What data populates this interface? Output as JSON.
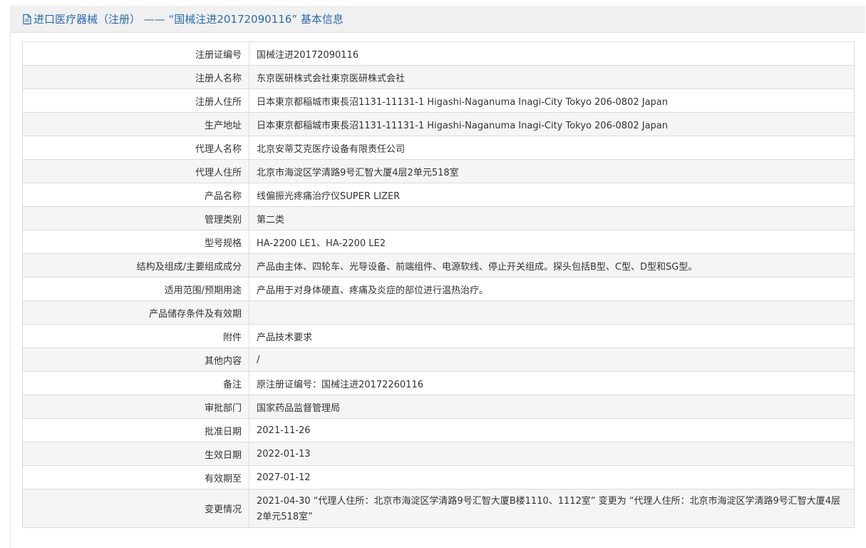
{
  "header": {
    "icon": "document-icon",
    "title": "进口医疗器械（注册） ——  “国械注进20172090116” 基本信息",
    "color": "#2a6bb0"
  },
  "rows": [
    {
      "label": "注册证编号",
      "value": "国械注进20172090116"
    },
    {
      "label": "注册人名称",
      "value": "东京医研株式会社東京医研株式会社"
    },
    {
      "label": "注册人住所",
      "value": "日本東京都稲城市東長沼1131-11131-1 Higashi-Naganuma Inagi-City Tokyo 206-0802 Japan"
    },
    {
      "label": "生产地址",
      "value": "日本東京都稲城市東長沼1131-11131-1 Higashi-Naganuma Inagi-City Tokyo 206-0802 Japan"
    },
    {
      "label": "代理人名称",
      "value": "北京安蒂艾克医疗设备有限责任公司"
    },
    {
      "label": "代理人住所",
      "value": "北京市海淀区学清路9号汇智大厦4层2单元518室"
    },
    {
      "label": "产品名称",
      "value": "线偏振光疼痛治疗仪SUPER LIZER"
    },
    {
      "label": "管理类别",
      "value": "第二类"
    },
    {
      "label": "型号规格",
      "value": "HA-2200 LE1、HA-2200 LE2"
    },
    {
      "label": "结构及组成/主要组成成分",
      "value": "产品由主体、四轮车、光导设备、前端组件、电源软线、停止开关组成。探头包括B型、C型、D型和SG型。"
    },
    {
      "label": "适用范围/预期用途",
      "value": "产品用于对身体硬直、疼痛及炎症的部位进行温热治疗。"
    },
    {
      "label": "产品储存条件及有效期",
      "value": ""
    },
    {
      "label": "附件",
      "value": "产品技术要求"
    },
    {
      "label": "其他内容",
      "value": "/"
    },
    {
      "label": "备注",
      "value": "原注册证编号：国械注进20172260116"
    },
    {
      "label": "审批部门",
      "value": "国家药品监督管理局"
    },
    {
      "label": "批准日期",
      "value": "2021-11-26"
    },
    {
      "label": "生效日期",
      "value": "2022-01-13"
    },
    {
      "label": "有效期至",
      "value": "2027-01-12"
    },
    {
      "label": "变更情况",
      "value": "2021-04-30 “代理人住所：北京市海淀区学清路9号汇智大厦B楼1110、1112室” 变更为 “代理人住所：北京市海淀区学清路9号汇智大厦4层2单元518室”"
    }
  ]
}
